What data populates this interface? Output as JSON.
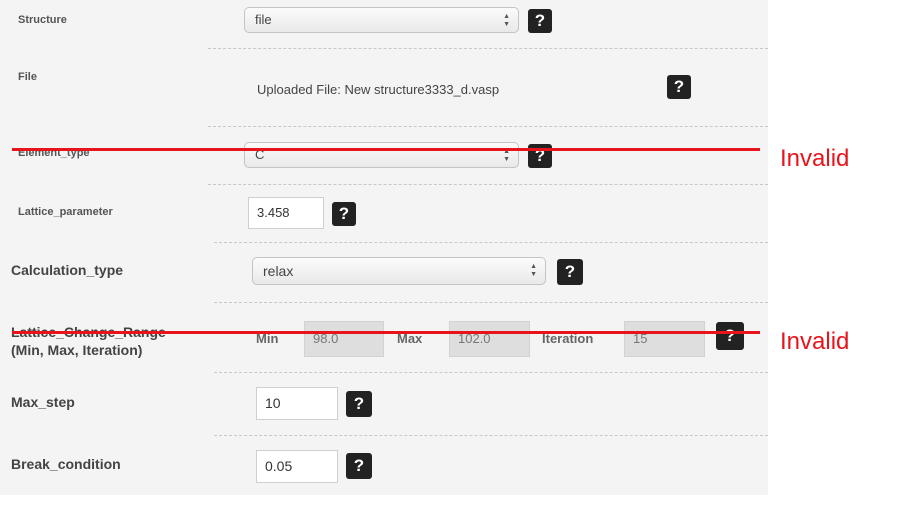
{
  "help_glyph": "?",
  "structure": {
    "label": "Structure",
    "value": "file"
  },
  "file": {
    "label": "File",
    "text": "Uploaded File: New structure3333_d.vasp"
  },
  "element_type": {
    "label": "Element_type",
    "value": "C"
  },
  "lattice_parameter": {
    "label": "Lattice_parameter",
    "value": "3.458"
  },
  "calculation_type": {
    "label": "Calculation_type",
    "value": "relax"
  },
  "lattice_change_range": {
    "label_line1": "Lattice_Change_Range",
    "label_line2": "(Min, Max, Iteration)",
    "min_label": "Min",
    "min_value": "98.0",
    "max_label": "Max",
    "max_value": "102.0",
    "iteration_label": "Iteration",
    "iteration_value": "15"
  },
  "max_step": {
    "label": "Max_step",
    "value": "10"
  },
  "break_condition": {
    "label": "Break_condition",
    "value": "0.05"
  },
  "annotations": {
    "invalid_1": "Invalid",
    "invalid_2": "Invalid",
    "color": "#e8141b"
  }
}
